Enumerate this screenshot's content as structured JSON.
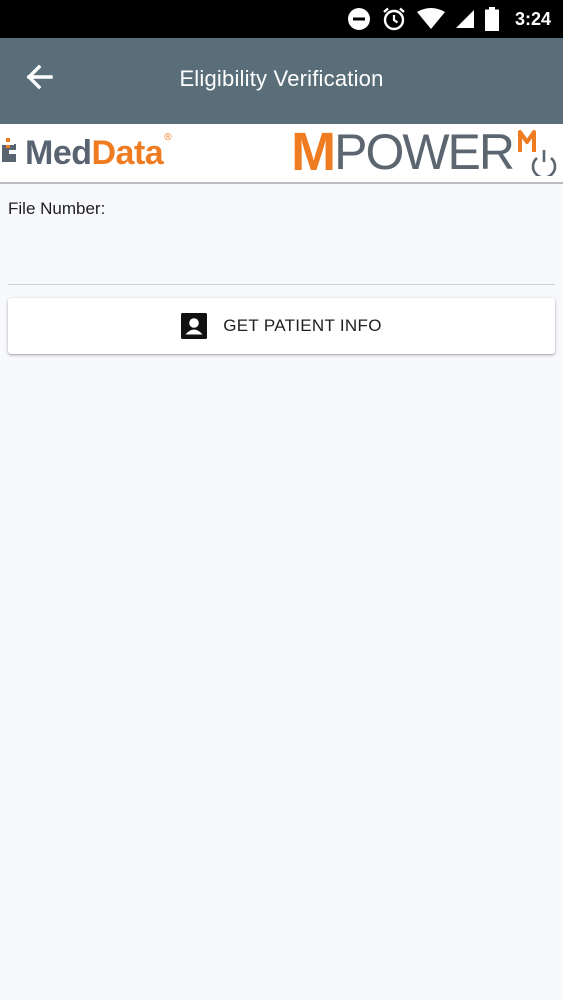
{
  "status_bar": {
    "time": "3:24",
    "icons": [
      "do-not-disturb-icon",
      "alarm-icon",
      "wifi-icon",
      "cellular-signal-icon",
      "battery-icon"
    ]
  },
  "app_bar": {
    "title": "Eligibility Verification",
    "back_icon": "arrow-back-icon",
    "background": "#5a6e7a"
  },
  "logos": {
    "left": {
      "part1": "Med",
      "part2": "Data",
      "registered": "®"
    },
    "right": {
      "initial": "M",
      "rest": "POWER"
    }
  },
  "form": {
    "file_number_label": "File Number:",
    "file_number_value": ""
  },
  "action": {
    "label": "GET PATIENT INFO",
    "icon": "patient-card-icon"
  },
  "colors": {
    "brand_orange": "#f07c22",
    "brand_gray": "#5a6470",
    "background": "#f8f9fc"
  }
}
